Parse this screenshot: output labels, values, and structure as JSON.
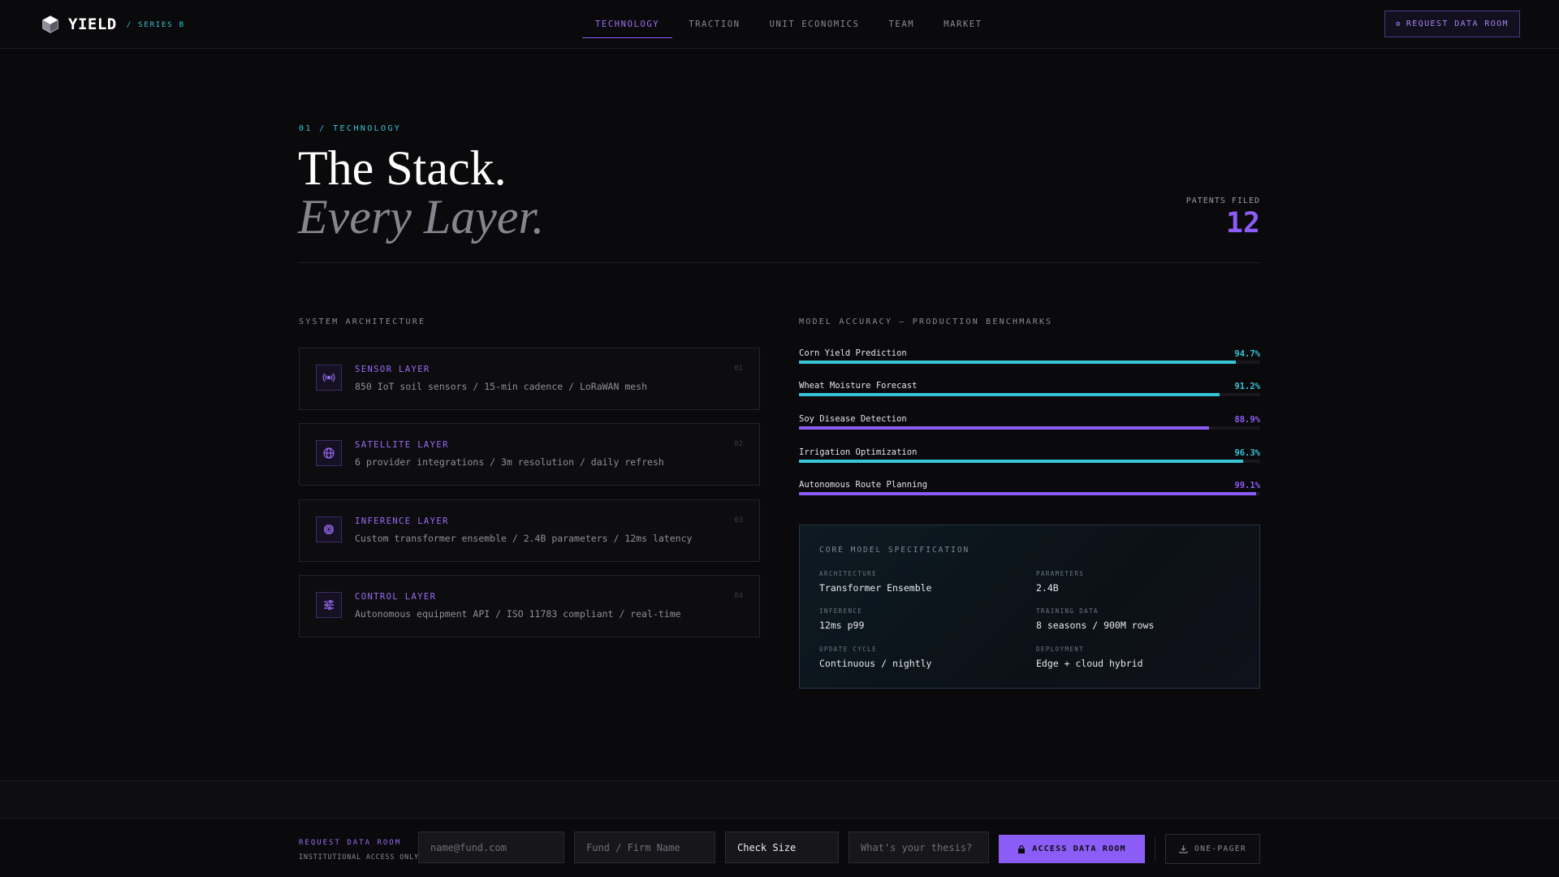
{
  "brand": {
    "name": "YIELD",
    "round": "/ SERIES B"
  },
  "nav": {
    "tabs": [
      {
        "label": "TECHNOLOGY",
        "active": true
      },
      {
        "label": "TRACTION",
        "active": false
      },
      {
        "label": "UNIT ECONOMICS",
        "active": false
      },
      {
        "label": "TEAM",
        "active": false
      },
      {
        "label": "MARKET",
        "active": false
      }
    ],
    "cta_label": "REQUEST DATA ROOM"
  },
  "hero": {
    "eyebrow": "01 / TECHNOLOGY",
    "title": "The Stack.",
    "subtitle": "Every Layer.",
    "patents_label": "PATENTS FILED",
    "patents_value": "12"
  },
  "architecture": {
    "heading": "SYSTEM ARCHITECTURE",
    "layers": [
      {
        "name": "SENSOR LAYER",
        "desc": "850 IoT soil sensors / 15-min cadence / LoRaWAN mesh",
        "num": "01",
        "icon": "signal-icon"
      },
      {
        "name": "SATELLITE LAYER",
        "desc": "6 provider integrations / 3m resolution / daily refresh",
        "num": "02",
        "icon": "globe-icon"
      },
      {
        "name": "INFERENCE LAYER",
        "desc": "Custom transformer ensemble / 2.4B parameters / 12ms latency",
        "num": "03",
        "icon": "chip-icon"
      },
      {
        "name": "CONTROL LAYER",
        "desc": "Autonomous equipment API / ISO 11783 compliant / real-time",
        "num": "04",
        "icon": "sliders-icon"
      }
    ]
  },
  "benchmarks": {
    "heading": "MODEL ACCURACY — PRODUCTION BENCHMARKS",
    "items": [
      {
        "label": "Corn Yield Prediction",
        "value": "94.7%",
        "fraction": 0.947,
        "color": "#38c3d6"
      },
      {
        "label": "Wheat Moisture Forecast",
        "value": "91.2%",
        "fraction": 0.912,
        "color": "#38c3d6"
      },
      {
        "label": "Soy Disease Detection",
        "value": "88.9%",
        "fraction": 0.889,
        "color": "#8b5cf6"
      },
      {
        "label": "Irrigation Optimization",
        "value": "96.3%",
        "fraction": 0.963,
        "color": "#38c3d6"
      },
      {
        "label": "Autonomous Route Planning",
        "value": "99.1%",
        "fraction": 0.991,
        "color": "#8b5cf6"
      }
    ]
  },
  "spec": {
    "title": "CORE MODEL SPECIFICATION",
    "items": [
      {
        "key": "ARCHITECTURE",
        "value": "Transformer Ensemble"
      },
      {
        "key": "PARAMETERS",
        "value": "2.4B"
      },
      {
        "key": "INFERENCE",
        "value": "12ms p99"
      },
      {
        "key": "TRAINING DATA",
        "value": "8 seasons / 900M rows"
      },
      {
        "key": "UPDATE CYCLE",
        "value": "Continuous / nightly"
      },
      {
        "key": "DEPLOYMENT",
        "value": "Edge + cloud hybrid"
      }
    ]
  },
  "footer": {
    "label": "REQUEST DATA ROOM",
    "note": "INSTITUTIONAL ACCESS ONLY",
    "email_placeholder": "name@fund.com",
    "firm_placeholder": "Fund / Firm Name",
    "check_size": "Check Size",
    "thesis_placeholder": "What's your thesis?",
    "access_label": "ACCESS DATA ROOM",
    "onepager_label": "ONE-PAGER"
  }
}
